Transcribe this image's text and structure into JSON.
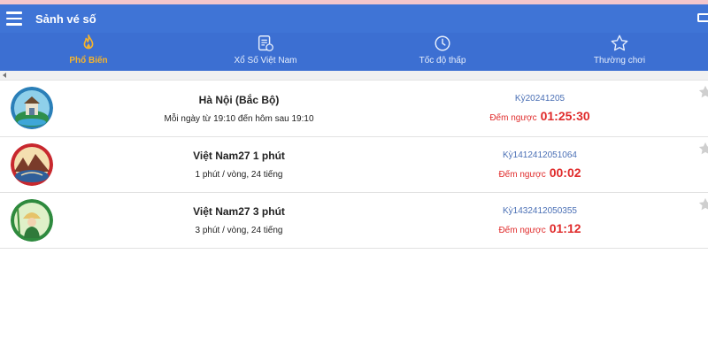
{
  "header": {
    "title": "Sảnh vé số",
    "menu_icon": "hamburger-menu-icon",
    "wallet_icon": "wallet-icon"
  },
  "tabs": [
    {
      "label": "Phổ Biến",
      "icon": "fire-icon",
      "active": true
    },
    {
      "label": "Xổ Số Việt Nam",
      "icon": "ticket-list-icon",
      "active": false
    },
    {
      "label": "Tốc độ thấp",
      "icon": "clock-icon",
      "active": false
    },
    {
      "label": "Thường chơi",
      "icon": "star-icon",
      "active": false
    }
  ],
  "colors": {
    "header_bg": "#3f74d6",
    "active_tab": "#f6b42c",
    "countdown": "#e02b2b",
    "period": "#4a6fb5"
  },
  "games": [
    {
      "name": "Hà Nội (Bắc Bộ)",
      "description": "Mỗi ngày từ 19:10 đến hôm sau 19:10",
      "period": "Kỳ20241205",
      "countdown_label": "Đếm ngược",
      "countdown": "01:25:30"
    },
    {
      "name": "Việt Nam27 1 phút",
      "description": "1 phút / vòng, 24 tiếng",
      "period": "Kỳ1412412051064",
      "countdown_label": "Đếm ngược",
      "countdown": "00:02"
    },
    {
      "name": "Việt Nam27 3 phút",
      "description": "3 phút / vòng, 24 tiếng",
      "period": "Kỳ1432412050355",
      "countdown_label": "Đếm ngược",
      "countdown": "01:12"
    }
  ]
}
